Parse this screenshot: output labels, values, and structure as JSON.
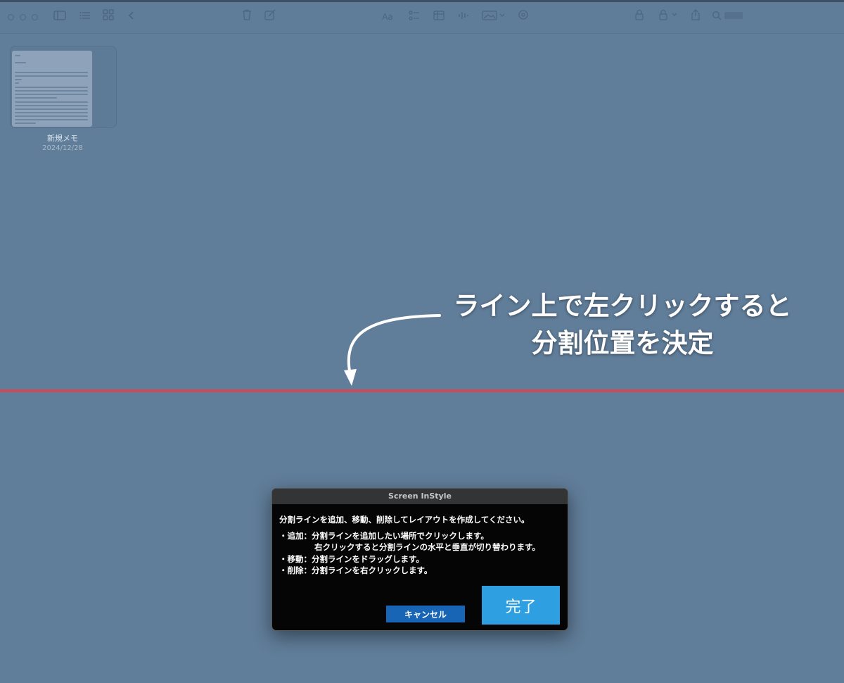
{
  "toolbar": {
    "icons": [
      "traffic-light-close",
      "traffic-light-minimize",
      "traffic-light-zoom",
      "sidebar-toggle",
      "list-view",
      "gallery-view",
      "back",
      "delete",
      "compose",
      "format",
      "checklist",
      "table",
      "media",
      "lock",
      "share",
      "search"
    ]
  },
  "note": {
    "title": "新規メモ",
    "date": "2024/12/28"
  },
  "annotation": {
    "line1": "ライン上で左クリックすると",
    "line2": "分割位置を決定"
  },
  "dialog": {
    "title": "Screen InStyle",
    "instruction": "分割ラインを追加、移動、削除してレイアウトを作成してください。",
    "add_line1": "・追加：分割ラインを追加したい場所でクリックします。",
    "add_line2": "右クリックすると分割ラインの水平と垂直が切り替わります。",
    "move_line": "・移動：分割ラインをドラッグします。",
    "delete_line": "・削除：分割ラインを右クリックします。",
    "cancel_label": "キャンセル",
    "done_label": "完了"
  },
  "colors": {
    "background": "#607d99",
    "split_line": "#cc4a5a",
    "dialog_bg": "#050505",
    "cancel_button": "#1865b6",
    "done_button": "#2e9fe0"
  }
}
